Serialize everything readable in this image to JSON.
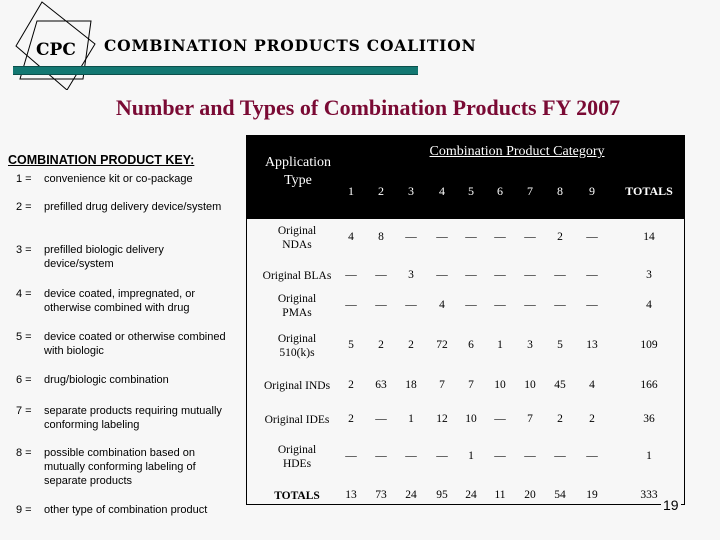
{
  "header": {
    "logo_mark": "CPC",
    "org_name": "COMBINATION PRODUCTS COALITION",
    "brand_color": "#137872"
  },
  "title": "Number and Types of Combination Products FY 2007",
  "title_color": "#7a0a34",
  "key": {
    "heading": "COMBINATION PRODUCT KEY:",
    "items": [
      {
        "num": "1 =",
        "desc": "convenience kit or co-package"
      },
      {
        "num": "2 =",
        "desc": "prefilled drug delivery device/system"
      },
      {
        "num": "3 =",
        "desc": "prefilled biologic delivery device/system"
      },
      {
        "num": "4 =",
        "desc": "device coated, impregnated, or otherwise combined with drug"
      },
      {
        "num": "5 =",
        "desc": "device coated or otherwise combined with biologic"
      },
      {
        "num": "6 =",
        "desc": "drug/biologic combination"
      },
      {
        "num": "7 =",
        "desc": "separate products requiring mutually conforming labeling"
      },
      {
        "num": "8 =",
        "desc": "possible combination based on mutually conforming labeling of separate products"
      },
      {
        "num": "9 =",
        "desc": "other type of combination product"
      }
    ]
  },
  "table": {
    "row_header_label": "Application Type",
    "category_label": "Combination Product Category",
    "columns": [
      "1",
      "2",
      "3",
      "4",
      "5",
      "6",
      "7",
      "8",
      "9",
      "TOTALS"
    ],
    "rows": [
      {
        "label": "Original NDAs",
        "values": [
          "4",
          "8",
          "—",
          "—",
          "—",
          "—",
          "—",
          "2",
          "—",
          "14"
        ]
      },
      {
        "label": "Original BLAs",
        "values": [
          "—",
          "—",
          "3",
          "—",
          "—",
          "—",
          "—",
          "—",
          "—",
          "3"
        ]
      },
      {
        "label": "Original PMAs",
        "values": [
          "—",
          "—",
          "—",
          "4",
          "—",
          "—",
          "—",
          "—",
          "—",
          "4"
        ]
      },
      {
        "label": "Original 510(k)s",
        "values": [
          "5",
          "2",
          "2",
          "72",
          "6",
          "1",
          "3",
          "5",
          "13",
          "109"
        ]
      },
      {
        "label": "Original INDs",
        "values": [
          "2",
          "63",
          "18",
          "7",
          "7",
          "10",
          "10",
          "45",
          "4",
          "166"
        ]
      },
      {
        "label": "Original IDEs",
        "values": [
          "2",
          "—",
          "1",
          "12",
          "10",
          "—",
          "7",
          "2",
          "2",
          "36"
        ]
      },
      {
        "label": "Original HDEs",
        "values": [
          "—",
          "—",
          "—",
          "—",
          "1",
          "—",
          "—",
          "—",
          "—",
          "1"
        ]
      },
      {
        "label": "TOTALS",
        "values": [
          "13",
          "73",
          "24",
          "95",
          "24",
          "11",
          "20",
          "54",
          "19",
          "333"
        ]
      }
    ]
  },
  "page_number": "19"
}
